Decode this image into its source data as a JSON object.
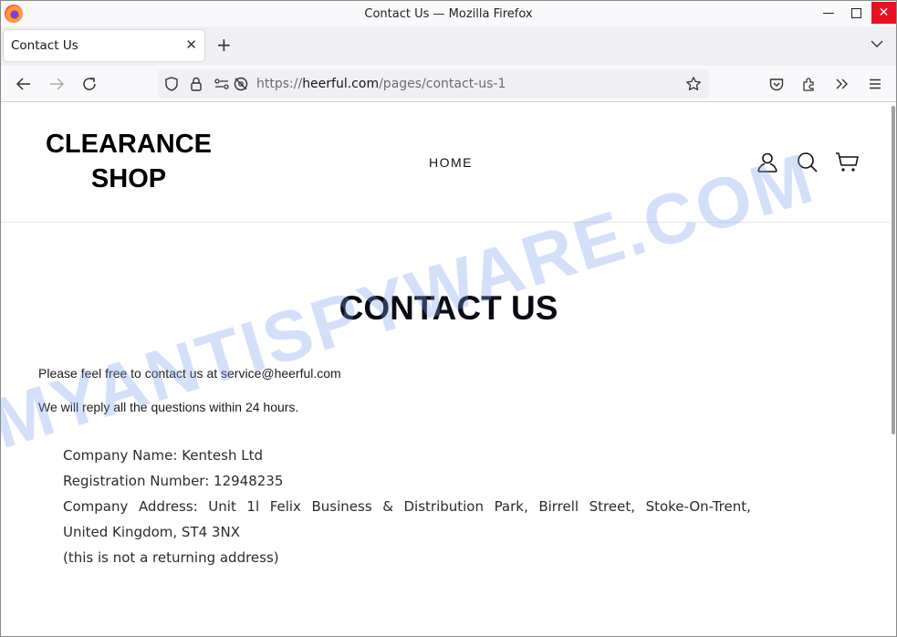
{
  "window": {
    "title": "Contact Us — Mozilla Firefox",
    "controls": {
      "minimize": "minimize",
      "maximize": "maximize",
      "close": "✕"
    }
  },
  "tabs": [
    {
      "label": "Contact Us",
      "active": true
    }
  ],
  "tab_close_glyph": "✕",
  "new_tab_glyph": "+",
  "navbar": {
    "url_scheme": "https://",
    "url_host": "heerful.com",
    "url_path": "/pages/contact-us-1"
  },
  "site": {
    "logo_line1": "CLEARANCE",
    "logo_line2": "SHOP",
    "nav": [
      {
        "label": "HOME"
      }
    ],
    "header_icons": [
      "account-icon",
      "search-icon",
      "cart-icon"
    ]
  },
  "content": {
    "title": "CONTACT US",
    "paragraph1": "Please feel free to contact us at service@heerful.com",
    "paragraph2": "We will reply all the questions within 24 hours.",
    "company": {
      "name_line": "Company Name: Kentesh Ltd",
      "registration_line": "Registration Number: 12948235",
      "address_words": [
        "Company",
        "Address:",
        "Unit",
        "1l",
        "Felix",
        "Business",
        "&",
        "Distribution",
        "Park,",
        "Birrell",
        "Street,",
        "Stoke-On-Trent,"
      ],
      "address_line2": "United Kingdom, ST4 3NX",
      "note": "(this is not a returning address)"
    }
  },
  "watermark": "MYANTISPYWARE.COM",
  "colors": {
    "close_button": "#e81123",
    "watermark": "#78a0f0"
  }
}
